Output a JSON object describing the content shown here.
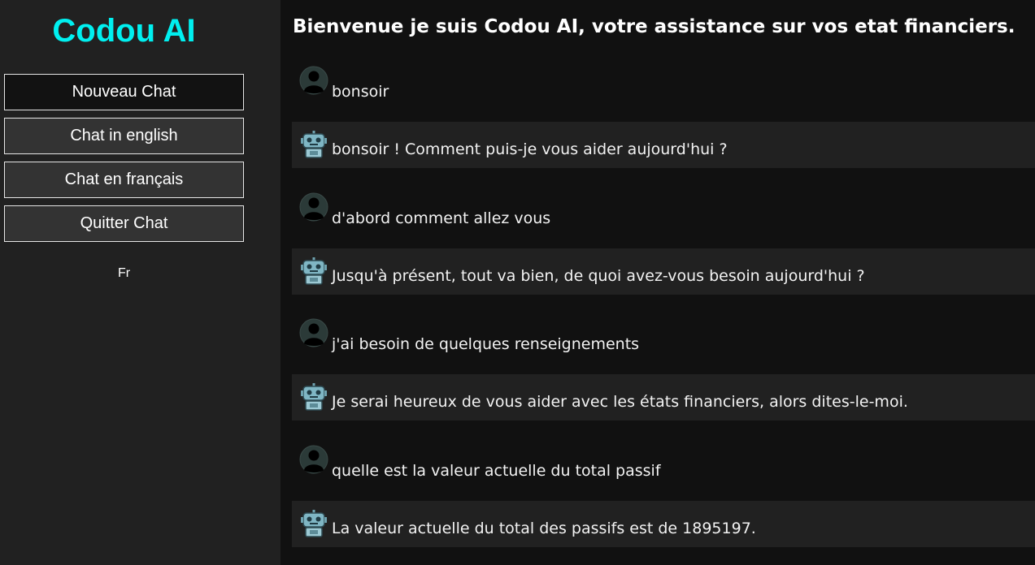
{
  "sidebar": {
    "brand": "Codou AI",
    "buttons": [
      {
        "label": "Nouveau Chat"
      },
      {
        "label": "Chat in english"
      },
      {
        "label": "Chat en français"
      },
      {
        "label": "Quitter Chat"
      }
    ],
    "language": "Fr"
  },
  "main": {
    "title": "Bienvenue je suis Codou AI, votre assistance sur vos etat financiers.",
    "messages": [
      {
        "role": "user",
        "avatar_icon": "user-avatar-icon",
        "text": "bonsoir"
      },
      {
        "role": "bot",
        "avatar_icon": "robot-avatar-icon",
        "text": "bonsoir ! Comment puis-je vous aider aujourd'hui ?"
      },
      {
        "role": "user",
        "avatar_icon": "user-avatar-icon",
        "text": "d'abord comment allez vous"
      },
      {
        "role": "bot",
        "avatar_icon": "robot-avatar-icon",
        "text": "Jusqu'à présent, tout va bien, de quoi avez-vous besoin aujourd'hui ?"
      },
      {
        "role": "user",
        "avatar_icon": "user-avatar-icon",
        "text": "j'ai besoin de quelques renseignements"
      },
      {
        "role": "bot",
        "avatar_icon": "robot-avatar-icon",
        "text": "Je serai heureux de vous aider avec les états financiers, alors dites-le-moi."
      },
      {
        "role": "user",
        "avatar_icon": "user-avatar-icon",
        "text": "quelle est la valeur actuelle du total passif"
      },
      {
        "role": "bot",
        "avatar_icon": "robot-avatar-icon",
        "text": "La valeur actuelle du total des passifs est de 1895197."
      }
    ]
  },
  "colors": {
    "brand": "#00f0f0",
    "sidebar_bg": "#212121",
    "main_bg": "#111111",
    "bot_row_bg": "#212121",
    "button_bg": "#333333",
    "active_button_bg": "#121212"
  }
}
